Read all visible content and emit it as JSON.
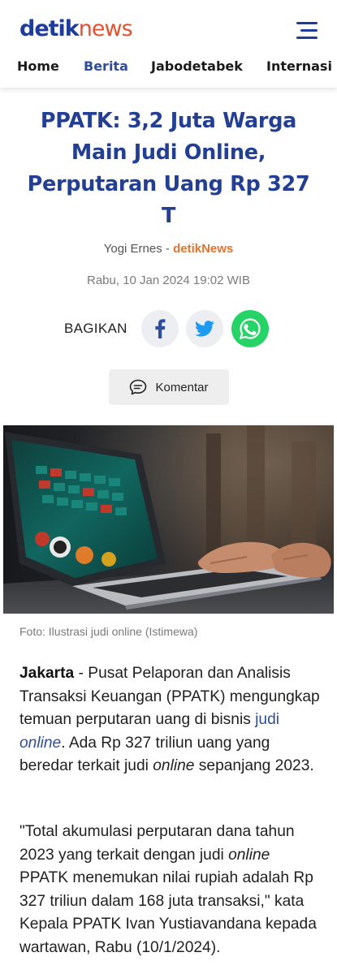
{
  "header": {
    "logo_part1": "detik",
    "logo_part2": "news",
    "nav": [
      "Home",
      "Berita",
      "Jabodetabek",
      "Internasi"
    ]
  },
  "article": {
    "title": "PPATK: 3,2 Juta Warga Main Judi Online, Perputaran Uang Rp 327 T",
    "author": "Yogi Ernes",
    "author_sep": " - ",
    "source": "detikNews",
    "date": "Rabu, 10 Jan 2024 19:02 WIB",
    "share_label": "BAGIKAN",
    "comment_label": "Komentar",
    "caption": "Foto: Ilustrasi judi online (Istimewa)",
    "p1": {
      "dateline": "Jakarta",
      "t1": " - Pusat Pelaporan dan Analisis Transaksi Keuangan (PPATK) mengungkap temuan perputaran uang di bisnis ",
      "link1": "judi",
      "link_space": " ",
      "link2": "online",
      "t2": ". Ada Rp 327 triliun uang yang beredar terkait judi ",
      "it1": "online",
      "t3": " sepanjang 2023."
    },
    "p2": {
      "t1": "\"Total akumulasi perputaran dana tahun 2023 yang terkait dengan judi ",
      "it1": "online",
      "t2": " PPATK menemukan nilai rupiah adalah Rp 327 triliun dalam 168 juta transaksi,\" kata Kepala PPATK Ivan Yustiavandana kepada wartawan, Rabu (10/1/2024)."
    }
  },
  "colors": {
    "brand_blue": "#223f93",
    "brand_orange": "#e4512f",
    "whatsapp": "#25d366"
  }
}
